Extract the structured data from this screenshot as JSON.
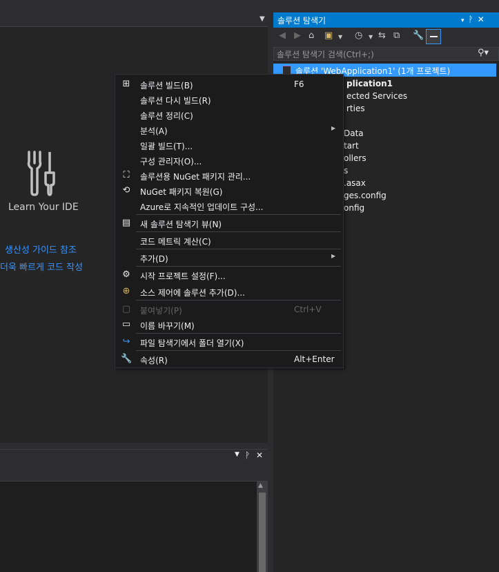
{
  "editor": {
    "learn_label": "Learn Your IDE",
    "links": [
      "생산성 가이드 참조",
      "더욱 빠르게 코드 작성"
    ]
  },
  "solution_explorer": {
    "title": "솔루션 탐색기",
    "title_buttons": [
      "▾",
      "ᚹ",
      "✕"
    ],
    "search_placeholder": "솔루션 탐색기 검색(Ctrl+;)",
    "selected_item": "솔루션 'WebApplication1' (1개 프로젝트)",
    "tree_items_visible": [
      "plication1",
      "ected Services",
      "rties",
      "Data",
      "tart",
      "ollers",
      "s",
      ".asax",
      "ges.config",
      "onfig"
    ]
  },
  "context_menu": {
    "items": [
      {
        "icon": "build-icon",
        "label": "솔루션 빌드(B)",
        "shortcut": "F6"
      },
      {
        "icon": "",
        "label": "솔루션 다시 빌드(R)",
        "shortcut": ""
      },
      {
        "icon": "",
        "label": "솔루션 정리(C)",
        "shortcut": ""
      },
      {
        "icon": "",
        "label": "분석(A)",
        "shortcut": "",
        "submenu": true
      },
      {
        "icon": "",
        "label": "일괄 빌드(T)...",
        "shortcut": ""
      },
      {
        "icon": "",
        "label": "구성 관리자(O)...",
        "shortcut": ""
      },
      {
        "icon": "nuget-icon",
        "label": "솔루션용 NuGet 패키지 관리...",
        "shortcut": ""
      },
      {
        "icon": "restore-icon",
        "label": "NuGet 패키지 복원(G)",
        "shortcut": ""
      },
      {
        "icon": "",
        "label": "Azure로 지속적인 업데이트 구성...",
        "shortcut": ""
      },
      {
        "icon": "new-view-icon",
        "label": "새 솔루션 탐색기 뷰(N)",
        "shortcut": ""
      },
      {
        "icon": "",
        "label": "코드 메트릭 계산(C)",
        "shortcut": ""
      },
      {
        "icon": "",
        "label": "추가(D)",
        "shortcut": "",
        "submenu": true
      },
      {
        "icon": "gear-icon",
        "label": "시작 프로젝트 설정(F)...",
        "shortcut": ""
      },
      {
        "icon": "source-control-icon",
        "label": "소스 제어에 솔루션 추가(D)...",
        "shortcut": ""
      },
      {
        "icon": "paste-icon",
        "label": "붙여넣기(P)",
        "shortcut": "Ctrl+V",
        "disabled": true
      },
      {
        "icon": "rename-icon",
        "label": "이름 바꾸기(M)",
        "shortcut": ""
      },
      {
        "icon": "open-folder-icon",
        "label": "파일 탐색기에서 폴더 열기(X)",
        "shortcut": ""
      },
      {
        "icon": "wrench-icon",
        "label": "속성(R)",
        "shortcut": "Alt+Enter"
      }
    ]
  },
  "colors": {
    "accent": "#007acc",
    "selection": "#3399ff",
    "link": "#3794ff"
  }
}
